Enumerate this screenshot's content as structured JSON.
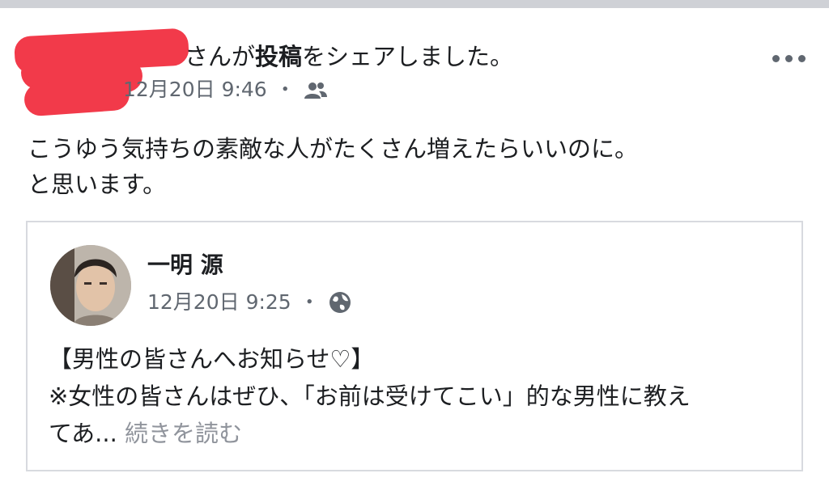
{
  "post": {
    "header_suffix_pre": "さんが",
    "header_bold": "投稿",
    "header_suffix_post": "をシェアしました。",
    "timestamp": "12月20日 9:46",
    "separator": "・",
    "audience_icon": "friends-icon",
    "text_line1": "こうゆう気持ちの素敵な人がたくさん増えたらいいのに。",
    "text_line2": "と思います。",
    "more_icon": "more-horizontal-icon"
  },
  "shared": {
    "author_name": "一明 源",
    "timestamp": "12月20日 9:25",
    "separator": "・",
    "audience_icon": "globe-icon",
    "body_line1": "【男性の皆さんへお知らせ♡】",
    "body_line2": "※女性の皆さんはぜひ、「お前は受けてこい」的な男性に教え",
    "body_line3_prefix": "てあ...",
    "see_more": "続きを読む"
  },
  "colors": {
    "redaction": "#f23a4a",
    "meta_text": "#606770",
    "see_more": "#90949c"
  }
}
